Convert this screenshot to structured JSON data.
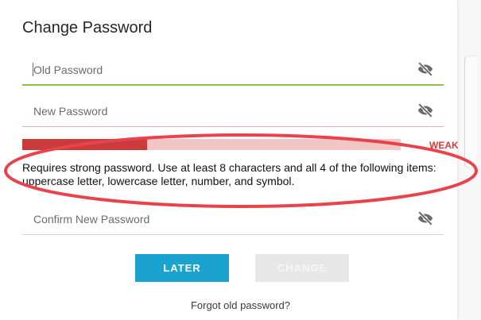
{
  "dialog": {
    "title": "Change Password"
  },
  "fields": {
    "old_password": {
      "placeholder": "Old Password",
      "state": "focused"
    },
    "new_password": {
      "placeholder": "New Password"
    },
    "confirm_password": {
      "placeholder": "Confirm New Password"
    }
  },
  "strength": {
    "label": "WEAK",
    "level": 0.33,
    "color": "#cc3b3b"
  },
  "hint": "Requires strong password. Use at least 8 characters and all 4 of the following items: uppercase letter, lowercase letter, number, and symbol.",
  "buttons": {
    "later": "LATER",
    "change": "CHANGE"
  },
  "links": {
    "forgot": "Forgot old password?"
  },
  "icons": {
    "visibility_toggle": "eye-off-icon"
  },
  "colors": {
    "accent": "#1aa3cf",
    "focus": "#8bc34a",
    "weak": "#d93a3a",
    "highlight": "#e8434a"
  }
}
